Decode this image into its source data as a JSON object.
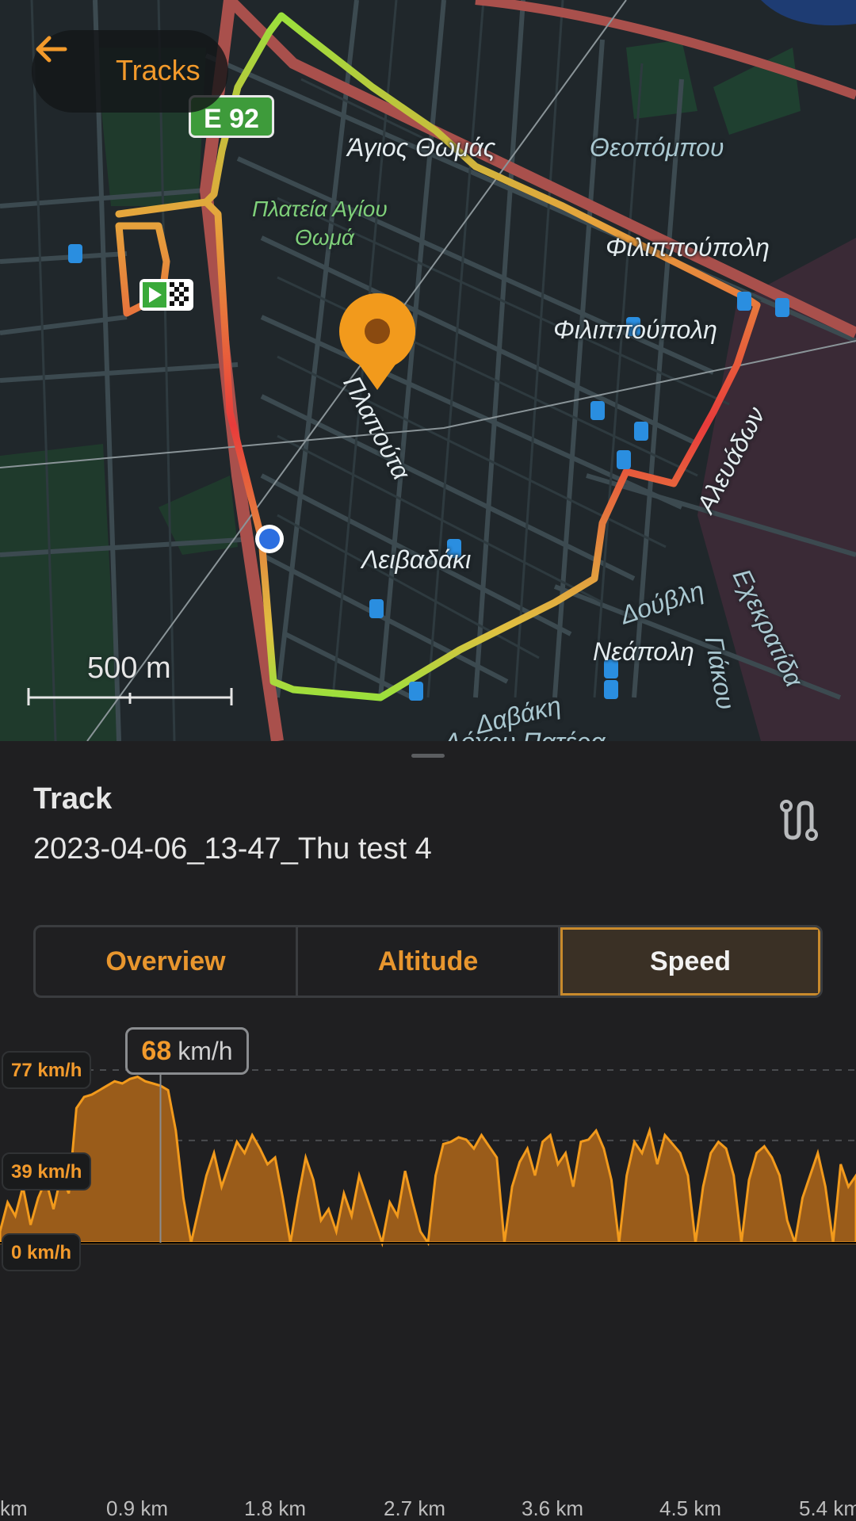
{
  "map": {
    "back_label": "Tracks",
    "highway_badge": "E 92",
    "labels": {
      "agios_thomas": "Άγιος Θωμάς",
      "plateia_1": "Πλατεία Αγίου",
      "plateia_2": "Θωμά",
      "theopompou": "Θεοπόμπου",
      "filippoupoli_1": "Φιλιππούπολη",
      "filippoupoli_2": "Φιλιππούπολη",
      "platoufa": "Πλαπούτα",
      "livadaki": "Λειβαδάκι",
      "aleuadon": "Αλευάδων",
      "douvli": "Δούβλη",
      "neapoli": "Νεάπολη",
      "ekekratida": "Εχεκρατίδα",
      "gatsou": "Γιάκου",
      "davaki": "Δαβάκη",
      "bottom_street": "Λόχου Πατέρα"
    },
    "scale_label": "500 m",
    "colors": {
      "route_fast": "#e83b3b",
      "route_slow": "#9be03c",
      "pin": "#f29a1c",
      "position": "#2d6fe0"
    }
  },
  "sheet": {
    "track_label": "Track",
    "track_name": "2023-04-06_13-47_Thu test 4",
    "tabs": [
      {
        "label": "Overview",
        "active": false
      },
      {
        "label": "Altitude",
        "active": false
      },
      {
        "label": "Speed",
        "active": true
      }
    ]
  },
  "tooltip": {
    "value": "68",
    "unit": "km/h"
  },
  "chart_data": {
    "type": "area",
    "title": "",
    "xlabel": "",
    "ylabel": "",
    "y_ticks": [
      "77 km/h",
      "39 km/h",
      "0 km/h"
    ],
    "x_ticks": [
      "km",
      "0.9 km",
      "1.8 km",
      "2.7 km",
      "3.6 km",
      "4.5 km",
      "5.4 km"
    ],
    "x_unit": "km",
    "y_unit": "km/h",
    "xlim": [
      0,
      5.6
    ],
    "ylim": [
      0,
      77
    ],
    "selected_x": 1.05,
    "selected_y": 68,
    "color": "#f29a1c",
    "x": [
      0,
      0.05,
      0.1,
      0.15,
      0.2,
      0.25,
      0.3,
      0.35,
      0.4,
      0.45,
      0.5,
      0.55,
      0.6,
      0.65,
      0.7,
      0.75,
      0.8,
      0.85,
      0.9,
      0.95,
      1.0,
      1.05,
      1.1,
      1.15,
      1.2,
      1.25,
      1.3,
      1.35,
      1.4,
      1.45,
      1.5,
      1.55,
      1.6,
      1.65,
      1.7,
      1.75,
      1.8,
      1.85,
      1.9,
      1.95,
      2.0,
      2.05,
      2.1,
      2.15,
      2.2,
      2.25,
      2.3,
      2.35,
      2.4,
      2.45,
      2.5,
      2.55,
      2.6,
      2.65,
      2.7,
      2.75,
      2.8,
      2.85,
      2.9,
      2.95,
      3.0,
      3.05,
      3.1,
      3.15,
      3.2,
      3.25,
      3.3,
      3.35,
      3.4,
      3.45,
      3.5,
      3.55,
      3.6,
      3.65,
      3.7,
      3.75,
      3.8,
      3.85,
      3.9,
      3.95,
      4.0,
      4.05,
      4.1,
      4.15,
      4.2,
      4.25,
      4.3,
      4.35,
      4.4,
      4.45,
      4.5,
      4.55,
      4.6,
      4.65,
      4.7,
      4.75,
      4.8,
      4.85,
      4.9,
      4.95,
      5.0,
      5.05,
      5.1,
      5.15,
      5.2,
      5.25,
      5.3,
      5.35,
      5.4,
      5.45,
      5.5,
      5.55,
      5.6
    ],
    "y": [
      5,
      18,
      12,
      25,
      8,
      20,
      28,
      15,
      30,
      22,
      60,
      65,
      66,
      68,
      70,
      72,
      71,
      73,
      74,
      72,
      71,
      70,
      68,
      50,
      20,
      0,
      15,
      30,
      40,
      25,
      35,
      45,
      40,
      48,
      42,
      35,
      38,
      20,
      0,
      20,
      38,
      28,
      10,
      15,
      5,
      22,
      12,
      30,
      20,
      10,
      0,
      18,
      12,
      32,
      18,
      5,
      0,
      30,
      44,
      45,
      47,
      46,
      42,
      48,
      43,
      38,
      0,
      25,
      36,
      42,
      30,
      45,
      48,
      35,
      40,
      25,
      45,
      46,
      50,
      42,
      28,
      0,
      30,
      45,
      40,
      50,
      35,
      48,
      44,
      40,
      30,
      0,
      25,
      40,
      45,
      42,
      30,
      0,
      28,
      40,
      43,
      38,
      30,
      10,
      0,
      20,
      30,
      40,
      25,
      0,
      35,
      25,
      30
    ]
  }
}
